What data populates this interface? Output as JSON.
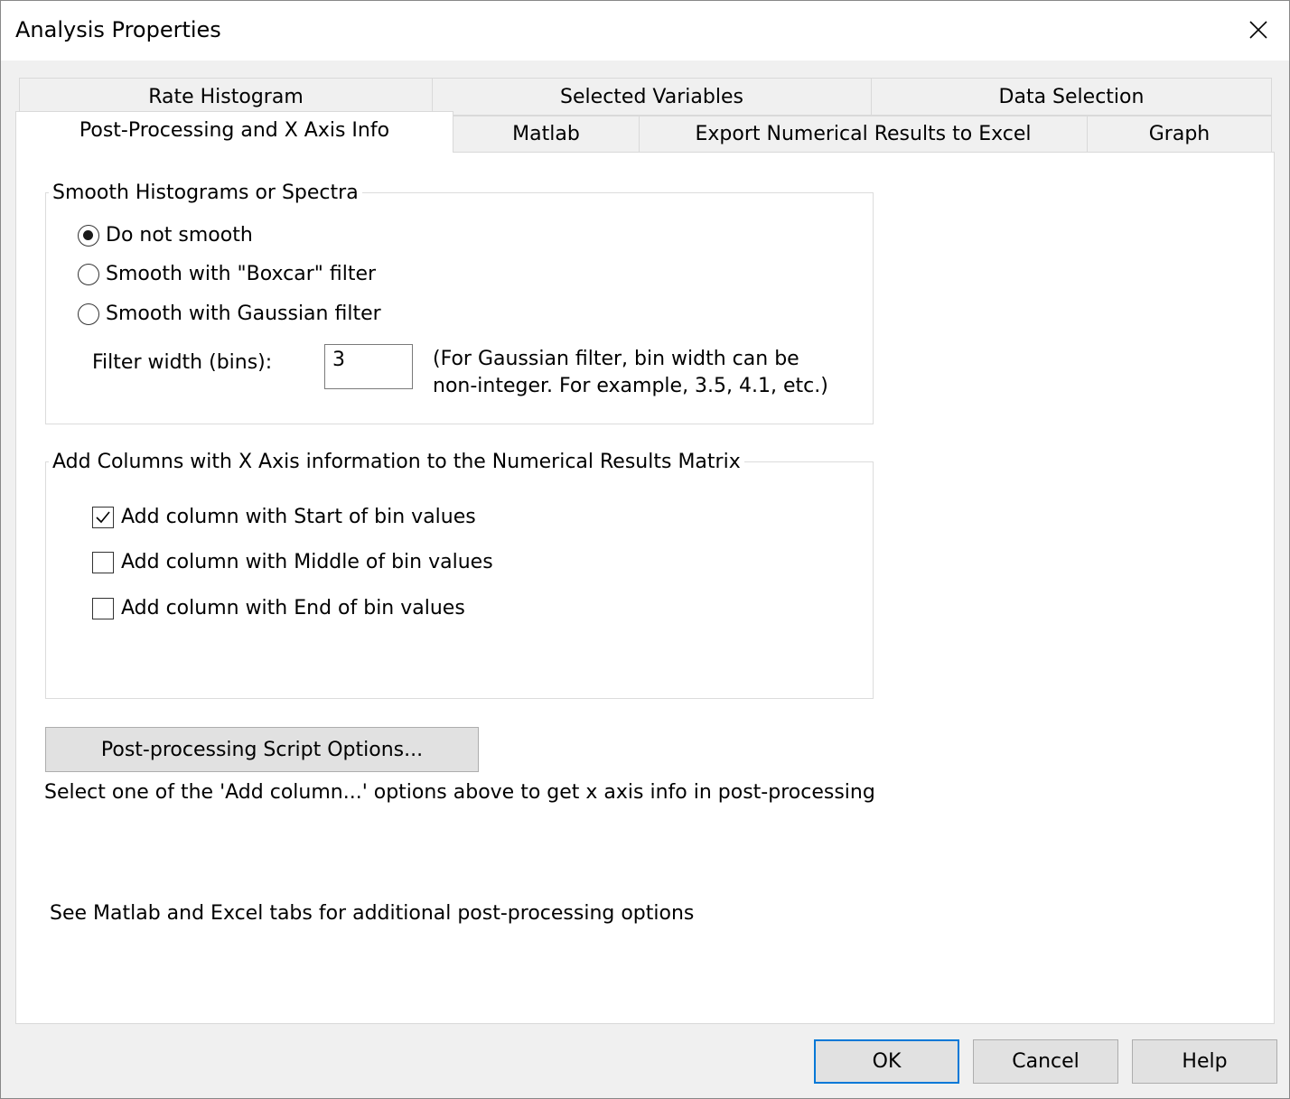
{
  "window": {
    "title": "Analysis Properties",
    "close_icon": "close-icon"
  },
  "tabs": {
    "row_back": [
      {
        "label": "Rate Histogram"
      },
      {
        "label": "Selected Variables"
      },
      {
        "label": "Data Selection"
      }
    ],
    "row_front": [
      {
        "label": "Post-Processing and X Axis Info",
        "active": true
      },
      {
        "label": "Matlab"
      },
      {
        "label": "Export Numerical Results to Excel"
      },
      {
        "label": "Graph"
      }
    ]
  },
  "smooth_group": {
    "title": "Smooth Histograms or Spectra",
    "options": [
      {
        "label": "Do not smooth",
        "checked": true
      },
      {
        "label": "Smooth with \"Boxcar\" filter",
        "checked": false
      },
      {
        "label": "Smooth with Gaussian filter",
        "checked": false
      }
    ],
    "filter_width_label": "Filter width (bins):",
    "filter_width_value": "3",
    "note_line1": "(For Gaussian filter, bin width can be",
    "note_line2": "non-integer. For example, 3.5, 4.1, etc.)"
  },
  "columns_group": {
    "title": "Add Columns with X Axis information to the Numerical Results Matrix",
    "options": [
      {
        "label": "Add column with Start of bin values",
        "checked": true
      },
      {
        "label": "Add column with Middle of bin values",
        "checked": false
      },
      {
        "label": "Add column with End of bin values",
        "checked": false
      }
    ]
  },
  "script_button": "Post-processing Script Options...",
  "hint_text": "Select one of the 'Add column...' options above to get x axis info in post-processing",
  "see_also_text": "See Matlab and Excel tabs for additional post-processing options",
  "buttons": {
    "ok": "OK",
    "cancel": "Cancel",
    "help": "Help"
  },
  "colors": {
    "accent": "#0078d7",
    "panel": "#ffffff",
    "background": "#f0f0f0"
  }
}
